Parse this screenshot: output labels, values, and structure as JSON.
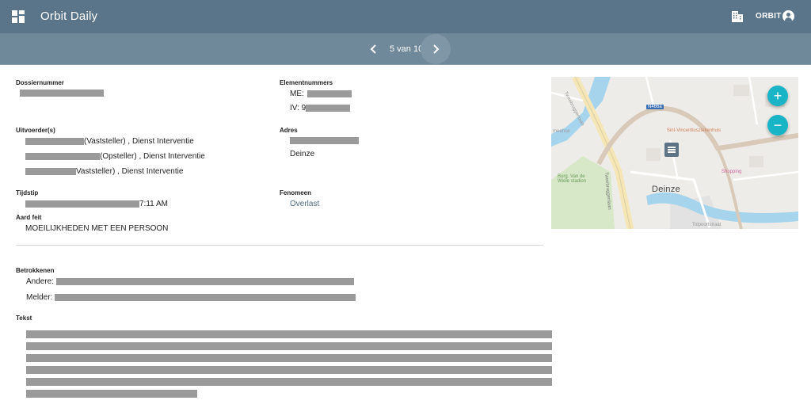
{
  "appbar": {
    "title": "Orbit Daily",
    "org": "ORBIT"
  },
  "pager": {
    "label": "5 van 10"
  },
  "fields": {
    "dossiernummer": {
      "label": "Dossiernummer"
    },
    "elementnummers": {
      "label": "Elementnummers",
      "me_prefix": "ME:",
      "iv_prefix": "IV: 9"
    },
    "uitvoerders": {
      "label": "Uitvoerder(s)",
      "items": [
        "(Vaststeller) , Dienst Interventie",
        "(Opsteller) , Dienst Interventie",
        "Vaststeller) , Dienst Interventie"
      ]
    },
    "adres": {
      "label": "Adres",
      "city": "Deinze"
    },
    "tijdstip": {
      "label": "Tijdstip",
      "time": "7:11 AM"
    },
    "fenomeen": {
      "label": "Fenomeen",
      "value": "Overlast"
    },
    "aard_feit": {
      "label": "Aard feit",
      "value": "MOEILIJKHEDEN MET EEN PERSOON"
    },
    "betrokkenen": {
      "label": "Betrokkenen",
      "andere": "Andere:",
      "melder": "Melder:"
    },
    "tekst": {
      "label": "Tekst"
    }
  },
  "map": {
    "road_number": "N466a",
    "city": "Deinze",
    "labels": {
      "tweebruggenlaan_1": "Tweebruggenlaan",
      "tweebruggenlaan_2": "Tweebruggenlaan",
      "sint_vincentius": "Sint-Vincentiusziekenhuis",
      "shopping": "Shopping",
      "burg_stadion": "Burg. Van de Wiele stadion",
      "tolpoortstraat": "Tolpoortstraat",
      "menee": "meence"
    },
    "zoom_in": "+",
    "zoom_out": "−",
    "colors": {
      "water": "#a6d4ec",
      "road": "#f5e6b8",
      "park": "#d4e6c5",
      "accent": "#19b4c6"
    }
  },
  "icons": [
    "grid-logo-icon",
    "building-icon",
    "account-circle-icon",
    "chevron-left-icon",
    "chevron-right-icon",
    "note-marker-icon"
  ]
}
